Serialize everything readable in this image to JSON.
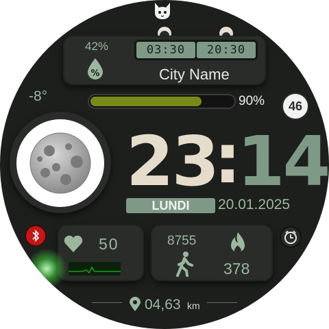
{
  "colors": {
    "face": "#1d1f1d",
    "panel": "#2a2c2a",
    "accent_green": "#9bb89f",
    "hour_color": "#e6dccb",
    "minute_color": "#7e9a86",
    "battery_fill": "#7a8a1a",
    "hr_graph": "#1aa01a",
    "alert_red": "#c21818"
  },
  "icons": {
    "top": "cat-icon",
    "sunrise": "sunrise-icon",
    "sunset": "sunset-icon",
    "humidity": "water-drop-percent-icon",
    "moon": "moon-icon",
    "bluetooth": "bluetooth-icon",
    "alarm": "alarm-clock-icon",
    "heart": "heart-icon",
    "steps": "walking-person-icon",
    "calories": "flame-icon",
    "location": "location-pin-icon"
  },
  "weather": {
    "humidity": "42%",
    "sunrise": "03:30",
    "sunset": "20:30",
    "city": "City Name",
    "temperature": "-8°"
  },
  "battery": {
    "label": "90%",
    "level": 0.9
  },
  "week_number": "46",
  "time": {
    "hour": "23",
    "separator": ":",
    "minute": "14"
  },
  "date": {
    "weekday": "LUNDI",
    "date": "20.01.2025"
  },
  "health": {
    "heart_rate": "50"
  },
  "activity": {
    "steps": "8755",
    "calories": "378"
  },
  "distance": {
    "value": "04,63",
    "unit": "km"
  }
}
